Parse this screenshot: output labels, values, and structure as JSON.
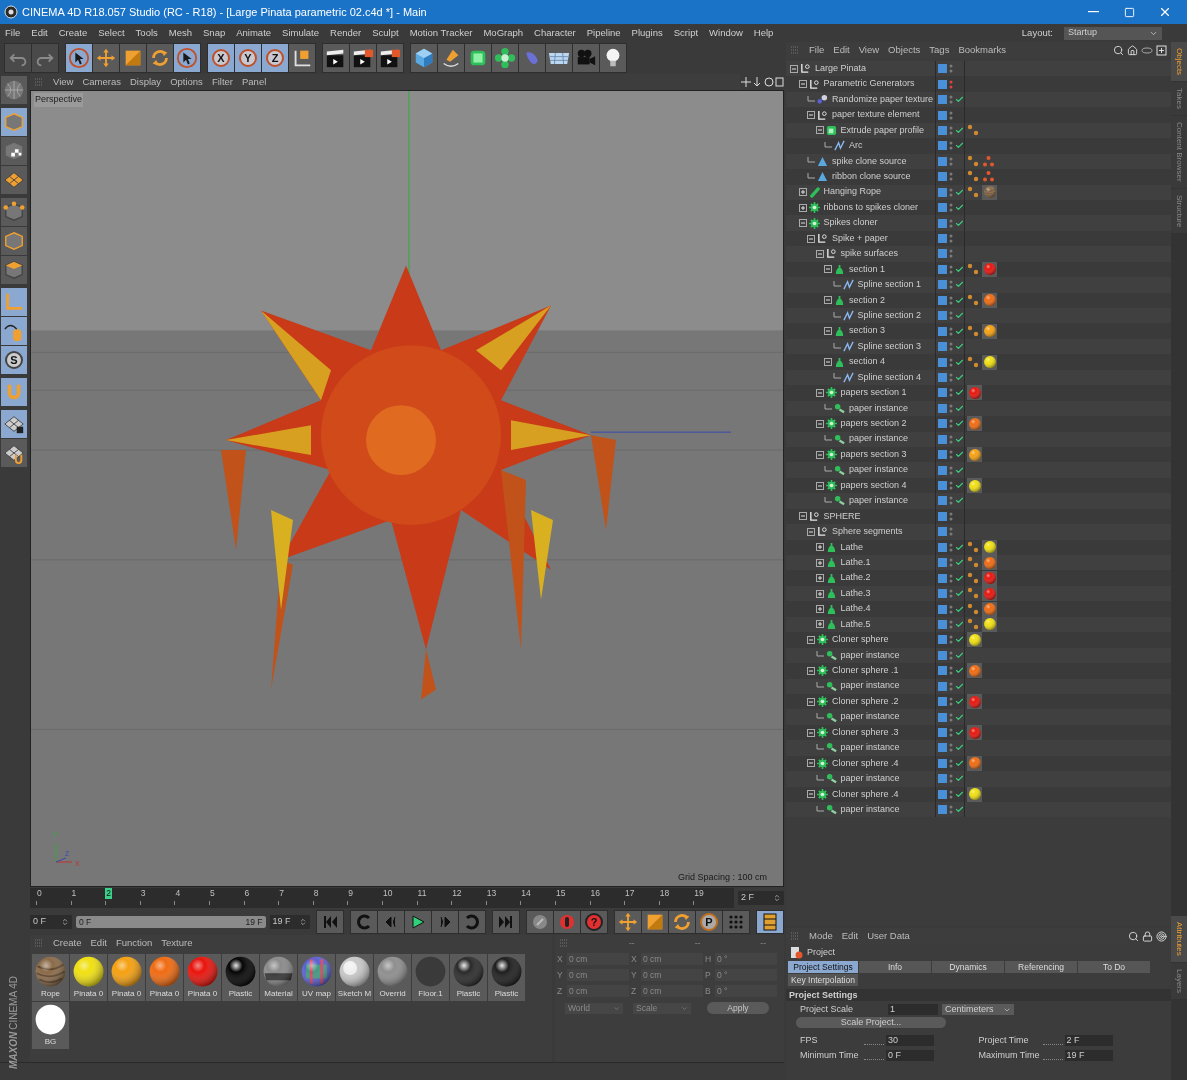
{
  "window": {
    "title": "CINEMA 4D R18.057 Studio (RC - R18) - [Large Pinata parametric 02.c4d *] - Main"
  },
  "menu": [
    "File",
    "Edit",
    "Create",
    "Select",
    "Tools",
    "Mesh",
    "Snap",
    "Animate",
    "Simulate",
    "Render",
    "Sculpt",
    "Motion Tracker",
    "MoGraph",
    "Character",
    "Pipeline",
    "Plugins",
    "Script",
    "Window",
    "Help"
  ],
  "layout": {
    "label": "Layout:",
    "value": "Startup"
  },
  "toolbar": [
    [
      {
        "kind": "undo",
        "selected": false,
        "disabled": true
      },
      {
        "kind": "redo",
        "selected": false,
        "disabled": true
      }
    ],
    [
      {
        "kind": "select",
        "selected": true
      },
      {
        "kind": "move",
        "selected": false
      },
      {
        "kind": "scale",
        "selected": false
      },
      {
        "kind": "rotate",
        "selected": false
      },
      {
        "kind": "select",
        "selected": true
      }
    ],
    [
      {
        "kind": "axis",
        "label": "X",
        "selected": true
      },
      {
        "kind": "axis",
        "label": "Y",
        "selected": true
      },
      {
        "kind": "axis",
        "label": "Z",
        "selected": true
      },
      {
        "kind": "coord",
        "selected": false
      }
    ],
    [
      {
        "kind": "render_view",
        "selected": false
      },
      {
        "kind": "render_picture",
        "selected": false
      },
      {
        "kind": "render_settings",
        "selected": false
      }
    ],
    [
      {
        "kind": "cube",
        "selected": false
      },
      {
        "kind": "pen",
        "selected": false
      },
      {
        "kind": "subdiv",
        "selected": false
      },
      {
        "kind": "cloner",
        "selected": false
      },
      {
        "kind": "deformer",
        "selected": false
      },
      {
        "kind": "floor",
        "selected": false
      },
      {
        "kind": "camera",
        "selected": false
      },
      {
        "kind": "light",
        "selected": false
      }
    ]
  ],
  "left_tools": [
    [
      {
        "kind": "make_editable",
        "selected": false
      }
    ],
    [
      {
        "kind": "model",
        "selected": true
      },
      {
        "kind": "texture",
        "selected": false
      },
      {
        "kind": "workplane",
        "selected": false
      }
    ],
    [
      {
        "kind": "points",
        "selected": false
      },
      {
        "kind": "edges",
        "selected": false
      },
      {
        "kind": "polygons",
        "selected": false
      }
    ],
    [
      {
        "kind": "axis_tool",
        "selected": true
      },
      {
        "kind": "tweak",
        "selected": true
      },
      {
        "kind": "snap",
        "label": "S",
        "selected": true
      }
    ],
    [
      {
        "kind": "magnet",
        "selected": true
      }
    ],
    [
      {
        "kind": "lock",
        "selected": true
      },
      {
        "kind": "planar",
        "selected": false
      }
    ]
  ],
  "logo": {
    "brand": "MAXON",
    "product": "CINEMA 4D"
  },
  "viewport": {
    "menu": [
      "View",
      "Cameras",
      "Display",
      "Options",
      "Filter",
      "Panel"
    ],
    "camera": "Perspective",
    "grid_spacing": "Grid Spacing : 100 cm",
    "axes": [
      "Y",
      "Z",
      "X"
    ]
  },
  "timeline": {
    "frames": [
      {
        "label": "0",
        "selected": false
      },
      {
        "label": "1",
        "selected": false
      },
      {
        "label": "2",
        "selected": true
      },
      {
        "label": "3",
        "selected": false
      },
      {
        "label": "4",
        "selected": false
      },
      {
        "label": "5",
        "selected": false
      },
      {
        "label": "6",
        "selected": false
      },
      {
        "label": "7",
        "selected": false
      },
      {
        "label": "8",
        "selected": false
      },
      {
        "label": "9",
        "selected": false
      },
      {
        "label": "10",
        "selected": false
      },
      {
        "label": "11",
        "selected": false
      },
      {
        "label": "12",
        "selected": false
      },
      {
        "label": "13",
        "selected": false
      },
      {
        "label": "14",
        "selected": false
      },
      {
        "label": "15",
        "selected": false
      },
      {
        "label": "16",
        "selected": false
      },
      {
        "label": "17",
        "selected": false
      },
      {
        "label": "18",
        "selected": false
      },
      {
        "label": "19",
        "selected": false
      }
    ],
    "current": "2 F"
  },
  "transport": {
    "start": "0 F",
    "range_start": "0 F",
    "range_end": "19 F",
    "level": 1,
    "end": "19 F",
    "buttons": [
      [
        {
          "kind": "first",
          "selected": false
        }
      ],
      [
        {
          "kind": "prev_key",
          "selected": false
        },
        {
          "kind": "prev_frame",
          "selected": false
        },
        {
          "kind": "play",
          "selected": false
        },
        {
          "kind": "next_frame",
          "selected": false
        },
        {
          "kind": "next_key",
          "selected": false
        }
      ],
      [
        {
          "kind": "last",
          "selected": false
        }
      ],
      [
        {
          "kind": "record",
          "selected": false
        },
        {
          "kind": "autokey",
          "selected": false
        },
        {
          "kind": "keysel",
          "label": "?",
          "selected": false
        }
      ],
      [
        {
          "kind": "pos",
          "selected": false
        },
        {
          "kind": "scl",
          "selected": false
        },
        {
          "kind": "rot",
          "selected": false
        },
        {
          "kind": "param",
          "label": "P",
          "selected": false
        },
        {
          "kind": "pla",
          "selected": false
        }
      ],
      [
        {
          "kind": "film",
          "selected": true
        }
      ]
    ]
  },
  "materials": {
    "menu": [
      "Create",
      "Edit",
      "Function",
      "Texture"
    ],
    "items": [
      {
        "name": "Rope",
        "kind": "wood",
        "color": "#8a6a48"
      },
      {
        "name": "Pinata 0",
        "kind": "matte",
        "color": "#f0e010"
      },
      {
        "name": "Pinata 0",
        "kind": "matte",
        "color": "#f5a010"
      },
      {
        "name": "Pinata 0",
        "kind": "matte",
        "color": "#f06a10"
      },
      {
        "name": "Pinata 0",
        "kind": "matte",
        "color": "#e8140c"
      },
      {
        "name": "Plastic",
        "kind": "glossy",
        "color": "#050505"
      },
      {
        "name": "Material",
        "kind": "chrome",
        "color": "#8a8a8a"
      },
      {
        "name": "UV map",
        "kind": "uv",
        "color": "#5a60d0"
      },
      {
        "name": "Sketch M",
        "kind": "sketch",
        "color": "#c8c8c8"
      },
      {
        "name": "Overrid",
        "kind": "matte",
        "color": "#8e8e8e"
      },
      {
        "name": "Floor.1",
        "kind": "blur",
        "color": "#3a3a3a"
      },
      {
        "name": "Plastic",
        "kind": "glossy",
        "color": "#2a2a2a"
      },
      {
        "name": "Plastic",
        "kind": "glossy",
        "color": "#1e1e1e"
      },
      {
        "name": "BG",
        "kind": "flat",
        "color": "#ffffff"
      }
    ]
  },
  "coordinates": {
    "headers": [
      "--",
      "--",
      "--"
    ],
    "rows": [
      {
        "axis": "X",
        "pos": "0 cm",
        "size_axis": "X",
        "size": "0 cm",
        "rot_axis": "H",
        "rot": "0 °"
      },
      {
        "axis": "Y",
        "pos": "0 cm",
        "size_axis": "Y",
        "size": "0 cm",
        "rot_axis": "P",
        "rot": "0 °"
      },
      {
        "axis": "Z",
        "pos": "0 cm",
        "size_axis": "Z",
        "size": "0 cm",
        "rot_axis": "B",
        "rot": "0 °"
      }
    ],
    "dropdowns": [
      "World",
      "Scale"
    ],
    "apply": "Apply"
  },
  "objects": {
    "menu": [
      "File",
      "Edit",
      "View",
      "Objects",
      "Tags",
      "Bookmarks"
    ],
    "tree": [
      {
        "name": "Large Pinata",
        "kind": "null",
        "expanded": true,
        "enabled": false,
        "hidden": false,
        "children": [
          {
            "name": "Parametric Generators",
            "kind": "null",
            "expanded": true,
            "enabled": false,
            "hidden": true,
            "children": [
              {
                "name": "Randomize paper texture",
                "kind": "effector",
                "enabled": true,
                "hidden": false
              },
              {
                "name": "paper texture element",
                "kind": "null",
                "expanded": true,
                "enabled": false,
                "hidden": false,
                "children": [
                  {
                    "name": "Extrude paper profile",
                    "kind": "extrude",
                    "expanded": true,
                    "enabled": true,
                    "hidden": false,
                    "tags": [
                      {
                        "kind": "phong"
                      }
                    ],
                    "children": [
                      {
                        "name": "Arc",
                        "kind": "spline",
                        "enabled": true,
                        "hidden": false
                      }
                    ]
                  }
                ]
              },
              {
                "name": "spike clone source",
                "kind": "mesh",
                "enabled": false,
                "hidden": false,
                "tags": [
                  {
                    "kind": "phong"
                  },
                  {
                    "kind": "points"
                  }
                ]
              },
              {
                "name": "ribbon clone source",
                "kind": "mesh",
                "enabled": false,
                "hidden": false,
                "tags": [
                  {
                    "kind": "phong"
                  },
                  {
                    "kind": "points"
                  }
                ]
              }
            ]
          },
          {
            "name": "Hanging Rope",
            "kind": "rope",
            "expanded": false,
            "enabled": true,
            "hidden": false,
            "tags": [
              {
                "kind": "phong"
              },
              {
                "kind": "texture"
              }
            ]
          },
          {
            "name": "ribbons to spikes cloner",
            "kind": "cloner",
            "expanded": false,
            "enabled": true,
            "hidden": false
          },
          {
            "name": "Spikes cloner",
            "kind": "cloner",
            "expanded": true,
            "enabled": true,
            "hidden": false,
            "children": [
              {
                "name": "Spike + paper",
                "kind": "null",
                "expanded": true,
                "enabled": false,
                "hidden": false,
                "children": [
                  {
                    "name": "spike surfaces",
                    "kind": "null",
                    "expanded": true,
                    "enabled": false,
                    "hidden": false,
                    "children": [
                      {
                        "name": "section 1",
                        "kind": "lathe",
                        "expanded": true,
                        "enabled": true,
                        "hidden": false,
                        "tags": [
                          {
                            "kind": "phong"
                          },
                          {
                            "kind": "material",
                            "color": "#e8140c"
                          }
                        ],
                        "children": [
                          {
                            "name": "Spline section 1",
                            "kind": "spline",
                            "enabled": true,
                            "hidden": false
                          }
                        ]
                      },
                      {
                        "name": "section 2",
                        "kind": "lathe",
                        "expanded": true,
                        "enabled": true,
                        "hidden": false,
                        "tags": [
                          {
                            "kind": "phong"
                          },
                          {
                            "kind": "material",
                            "color": "#f06a10"
                          }
                        ],
                        "children": [
                          {
                            "name": "Spline section 2",
                            "kind": "spline",
                            "enabled": true,
                            "hidden": false
                          }
                        ]
                      },
                      {
                        "name": "section 3",
                        "kind": "lathe",
                        "expanded": true,
                        "enabled": true,
                        "hidden": false,
                        "tags": [
                          {
                            "kind": "phong"
                          },
                          {
                            "kind": "material",
                            "color": "#f5a010"
                          }
                        ],
                        "children": [
                          {
                            "name": "Spline section 3",
                            "kind": "spline",
                            "enabled": true,
                            "hidden": false
                          }
                        ]
                      },
                      {
                        "name": "section 4",
                        "kind": "lathe",
                        "expanded": true,
                        "enabled": true,
                        "hidden": false,
                        "tags": [
                          {
                            "kind": "phong"
                          },
                          {
                            "kind": "material",
                            "color": "#f0e010"
                          }
                        ],
                        "children": [
                          {
                            "name": "Spline section 4",
                            "kind": "spline",
                            "enabled": true,
                            "hidden": false
                          }
                        ]
                      }
                    ]
                  },
                  {
                    "name": "papers section 1",
                    "kind": "cloner",
                    "expanded": true,
                    "enabled": true,
                    "hidden": false,
                    "tags": [
                      {
                        "kind": "material",
                        "color": "#e8140c"
                      }
                    ],
                    "children": [
                      {
                        "name": "paper instance",
                        "kind": "instance",
                        "enabled": true,
                        "hidden": false
                      }
                    ]
                  },
                  {
                    "name": "papers section 2",
                    "kind": "cloner",
                    "expanded": true,
                    "enabled": true,
                    "hidden": false,
                    "tags": [
                      {
                        "kind": "material",
                        "color": "#f06a10"
                      }
                    ],
                    "children": [
                      {
                        "name": "paper instance",
                        "kind": "instance",
                        "enabled": true,
                        "hidden": false
                      }
                    ]
                  },
                  {
                    "name": "papers section 3",
                    "kind": "cloner",
                    "expanded": true,
                    "enabled": true,
                    "hidden": false,
                    "tags": [
                      {
                        "kind": "material",
                        "color": "#f5a010"
                      }
                    ],
                    "children": [
                      {
                        "name": "paper instance",
                        "kind": "instance",
                        "enabled": true,
                        "hidden": false
                      }
                    ]
                  },
                  {
                    "name": "papers section 4",
                    "kind": "cloner",
                    "expanded": true,
                    "enabled": true,
                    "hidden": false,
                    "tags": [
                      {
                        "kind": "material",
                        "color": "#f0e010"
                      }
                    ],
                    "children": [
                      {
                        "name": "paper instance",
                        "kind": "instance",
                        "enabled": true,
                        "hidden": false
                      }
                    ]
                  }
                ]
              }
            ]
          },
          {
            "name": "SPHERE",
            "kind": "null",
            "expanded": true,
            "enabled": false,
            "hidden": false,
            "children": [
              {
                "name": "Sphere segments",
                "kind": "null",
                "expanded": true,
                "enabled": false,
                "hidden": false,
                "children": [
                  {
                    "name": "Lathe",
                    "kind": "lathe",
                    "expanded": false,
                    "enabled": true,
                    "hidden": false,
                    "tags": [
                      {
                        "kind": "phong"
                      },
                      {
                        "kind": "material",
                        "color": "#f0e010"
                      }
                    ]
                  },
                  {
                    "name": "Lathe.1",
                    "kind": "lathe",
                    "expanded": false,
                    "enabled": true,
                    "hidden": false,
                    "tags": [
                      {
                        "kind": "phong"
                      },
                      {
                        "kind": "material",
                        "color": "#f06a10"
                      }
                    ]
                  },
                  {
                    "name": "Lathe.2",
                    "kind": "lathe",
                    "expanded": false,
                    "enabled": true,
                    "hidden": false,
                    "tags": [
                      {
                        "kind": "phong"
                      },
                      {
                        "kind": "material",
                        "color": "#e8140c"
                      }
                    ]
                  },
                  {
                    "name": "Lathe.3",
                    "kind": "lathe",
                    "expanded": false,
                    "enabled": true,
                    "hidden": false,
                    "tags": [
                      {
                        "kind": "phong"
                      },
                      {
                        "kind": "material",
                        "color": "#e8140c"
                      }
                    ]
                  },
                  {
                    "name": "Lathe.4",
                    "kind": "lathe",
                    "expanded": false,
                    "enabled": true,
                    "hidden": false,
                    "tags": [
                      {
                        "kind": "phong"
                      },
                      {
                        "kind": "material",
                        "color": "#f06a10"
                      }
                    ]
                  },
                  {
                    "name": "Lathe.5",
                    "kind": "lathe",
                    "expanded": false,
                    "enabled": true,
                    "hidden": false,
                    "tags": [
                      {
                        "kind": "phong"
                      },
                      {
                        "kind": "material",
                        "color": "#f0e010"
                      }
                    ]
                  }
                ]
              },
              {
                "name": "Cloner sphere",
                "kind": "cloner",
                "expanded": true,
                "enabled": true,
                "hidden": false,
                "tags": [
                  {
                    "kind": "material",
                    "color": "#f0e010"
                  }
                ],
                "children": [
                  {
                    "name": "paper instance",
                    "kind": "instance",
                    "enabled": true,
                    "hidden": false
                  }
                ]
              },
              {
                "name": "Cloner sphere .1",
                "kind": "cloner",
                "expanded": true,
                "enabled": true,
                "hidden": false,
                "tags": [
                  {
                    "kind": "material",
                    "color": "#f06a10"
                  }
                ],
                "children": [
                  {
                    "name": "paper instance",
                    "kind": "instance",
                    "enabled": true,
                    "hidden": false
                  }
                ]
              },
              {
                "name": "Cloner sphere .2",
                "kind": "cloner",
                "expanded": true,
                "enabled": true,
                "hidden": false,
                "tags": [
                  {
                    "kind": "material",
                    "color": "#e8140c"
                  }
                ],
                "children": [
                  {
                    "name": "paper instance",
                    "kind": "instance",
                    "enabled": true,
                    "hidden": false
                  }
                ]
              },
              {
                "name": "Cloner sphere .3",
                "kind": "cloner",
                "expanded": true,
                "enabled": true,
                "hidden": false,
                "tags": [
                  {
                    "kind": "material",
                    "color": "#e8140c"
                  }
                ],
                "children": [
                  {
                    "name": "paper instance",
                    "kind": "instance",
                    "enabled": true,
                    "hidden": false
                  }
                ]
              },
              {
                "name": "Cloner sphere .4",
                "kind": "cloner",
                "expanded": true,
                "enabled": true,
                "hidden": false,
                "tags": [
                  {
                    "kind": "material",
                    "color": "#f06a10"
                  }
                ],
                "children": [
                  {
                    "name": "paper instance",
                    "kind": "instance",
                    "enabled": true,
                    "hidden": false
                  }
                ]
              },
              {
                "name": "Cloner sphere .4",
                "kind": "cloner",
                "expanded": true,
                "enabled": true,
                "hidden": false,
                "tags": [
                  {
                    "kind": "material",
                    "color": "#f0e010"
                  }
                ],
                "children": [
                  {
                    "name": "paper instance",
                    "kind": "instance",
                    "enabled": true,
                    "hidden": false
                  }
                ]
              }
            ]
          }
        ]
      }
    ]
  },
  "side_tabs": [
    {
      "label": "Objects",
      "selected": true
    },
    {
      "label": "Takes",
      "selected": false
    },
    {
      "label": "Content Browser",
      "selected": false
    },
    {
      "label": "Structure",
      "selected": false
    }
  ],
  "attributes": {
    "menu": [
      "Mode",
      "Edit",
      "User Data"
    ],
    "title": "Project",
    "tabs": [
      {
        "label": "Project Settings",
        "selected": true
      },
      {
        "label": "Info",
        "selected": false
      },
      {
        "label": "Dynamics",
        "selected": false
      },
      {
        "label": "Referencing",
        "selected": false
      },
      {
        "label": "To Do",
        "selected": false
      },
      {
        "label": "Key Interpolation",
        "selected": false
      }
    ],
    "section": "Project Settings",
    "scale": {
      "label": "Project Scale",
      "value": "1",
      "unit": "Centimeters"
    },
    "scale_button": "Scale Project...",
    "fields": [
      {
        "label": "FPS",
        "value": "30"
      },
      {
        "label": "Project Time",
        "value": "2 F"
      },
      {
        "label": "Minimum Time",
        "value": "0 F"
      },
      {
        "label": "Maximum Time",
        "value": "19 F"
      }
    ]
  },
  "side_tabs_lower": [
    {
      "label": "Attributes",
      "selected": true
    },
    {
      "label": "Layers",
      "selected": false
    }
  ]
}
